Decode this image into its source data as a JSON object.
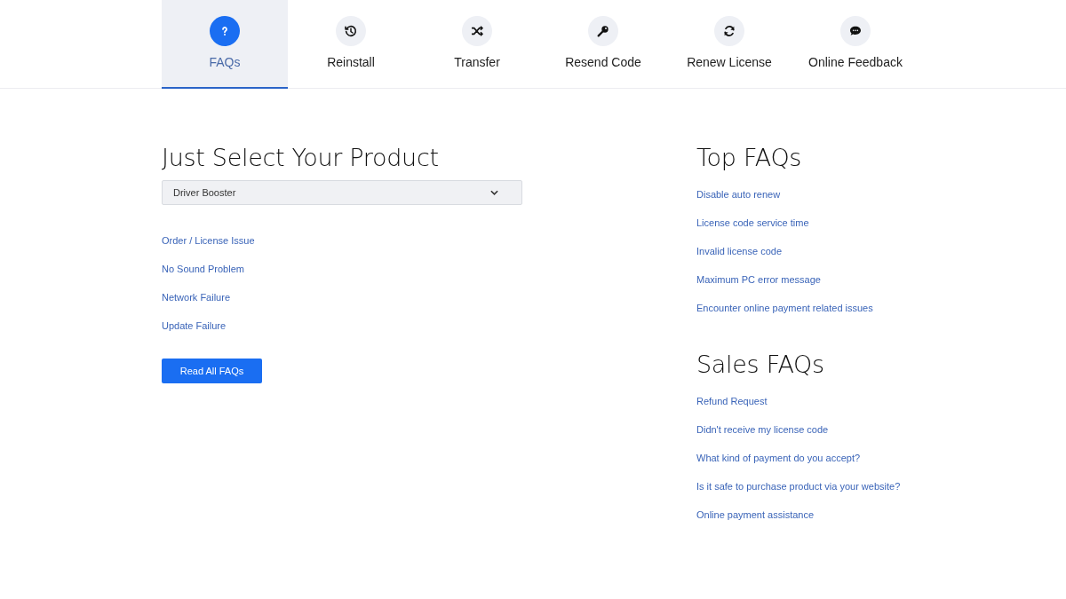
{
  "tabs": [
    {
      "label": "FAQs",
      "kind": "help",
      "selected": true
    },
    {
      "label": "Reinstall",
      "kind": "history",
      "selected": false
    },
    {
      "label": "Transfer",
      "kind": "shuffle",
      "selected": false
    },
    {
      "label": "Resend Code",
      "kind": "key",
      "selected": false
    },
    {
      "label": "Renew License",
      "kind": "sync",
      "selected": false
    },
    {
      "label": "Online Feedback",
      "kind": "chat",
      "selected": false
    }
  ],
  "product": {
    "heading": "Just Select Your Product",
    "select_value": "Driver Booster",
    "links": [
      "Order / License Issue",
      "No Sound Problem",
      "Network Failure",
      "Update Failure"
    ],
    "button": "Read All FAQs"
  },
  "top_faqs": {
    "heading": "Top FAQs",
    "links": [
      "Disable auto renew",
      "License code service time",
      "Invalid license code",
      "Maximum PC error message",
      "Encounter online payment related issues"
    ]
  },
  "sales_faqs": {
    "heading": "Sales FAQs",
    "links": [
      "Refund Request",
      "Didn't receive my license code",
      "What kind of payment do you accept?",
      "Is it safe to purchase product via your website?",
      "Online payment assistance"
    ]
  }
}
